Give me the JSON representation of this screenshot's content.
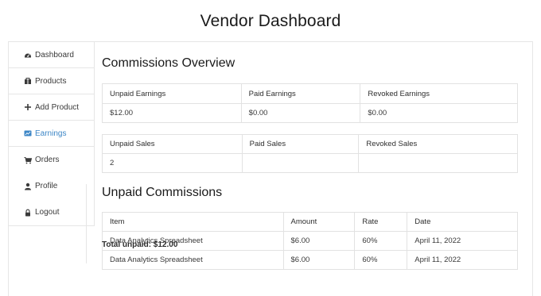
{
  "page": {
    "title": "Vendor Dashboard"
  },
  "sidebar": {
    "items": [
      {
        "label": "Dashboard",
        "icon": "dashboard-icon"
      },
      {
        "label": "Products",
        "icon": "products-icon"
      },
      {
        "label": "Add Product",
        "icon": "plus-icon"
      },
      {
        "label": "Earnings",
        "icon": "earnings-icon",
        "active": true
      },
      {
        "label": "Orders",
        "icon": "cart-icon"
      },
      {
        "label": "Profile",
        "icon": "user-icon"
      },
      {
        "label": "Logout",
        "icon": "lock-icon"
      }
    ],
    "active_color": "#3c86c6"
  },
  "overview": {
    "title": "Commissions Overview",
    "earnings_headers": [
      "Unpaid Earnings",
      "Paid Earnings",
      "Revoked Earnings"
    ],
    "earnings_values": [
      "$12.00",
      "$0.00",
      "$0.00"
    ],
    "sales_headers": [
      "Unpaid Sales",
      "Paid Sales",
      "Revoked Sales"
    ],
    "sales_values": [
      "2",
      "",
      ""
    ]
  },
  "unpaid": {
    "title": "Unpaid Commissions",
    "headers": [
      "Item",
      "Amount",
      "Rate",
      "Date"
    ],
    "rows": [
      [
        "Data Analytics Spreadsheet",
        "$6.00",
        "60%",
        "April 11, 2022"
      ],
      [
        "Data Analytics Spreadsheet",
        "$6.00",
        "60%",
        "April 11, 2022"
      ]
    ],
    "total": "Total unpaid: $12.00"
  }
}
